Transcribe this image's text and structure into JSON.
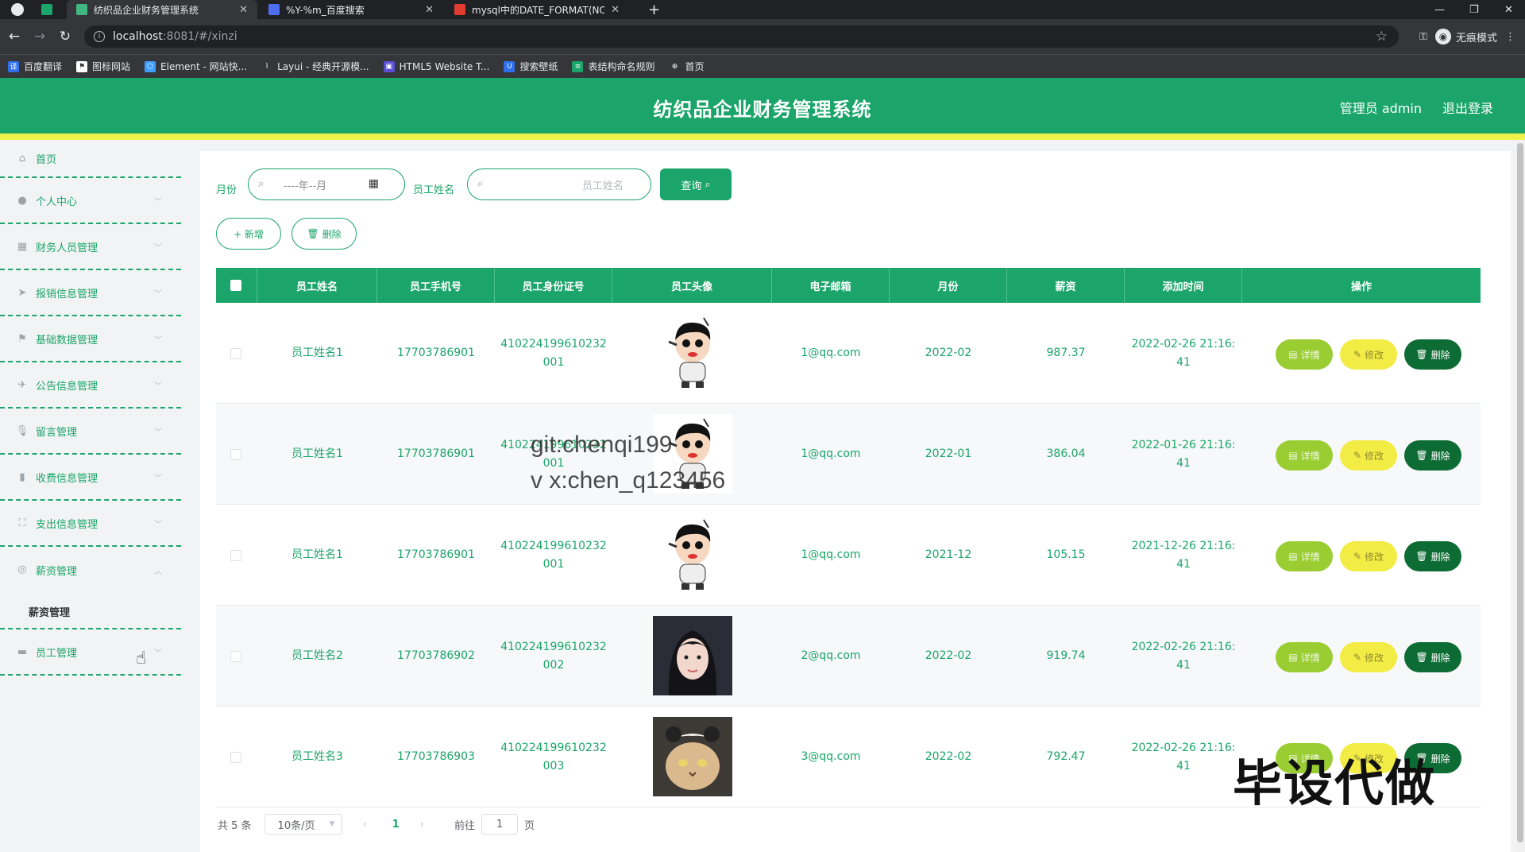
{
  "browser": {
    "tabs": [
      {
        "title": "纺织品企业财务管理系统"
      },
      {
        "title": "%Y-%m_百度搜索"
      },
      {
        "title": "mysql中的DATE_FORMAT(NO"
      }
    ],
    "url_host": "localhost",
    "url_path": ":8081/#/xinzi",
    "incognito_label": "无痕模式",
    "bookmarks": [
      "百度翻译",
      "图标网站",
      "Element - 网站快...",
      "Layui - 经典开源模...",
      "HTML5 Website T...",
      "搜索壁纸",
      "表结构命名规则",
      "首页"
    ]
  },
  "header": {
    "title": "纺织品企业财务管理系统",
    "user": "管理员 admin",
    "logout": "退出登录"
  },
  "sidebar": {
    "items": [
      {
        "label": "首页",
        "icon": "home-icon"
      },
      {
        "label": "个人中心",
        "icon": "user-icon"
      },
      {
        "label": "财务人员管理",
        "icon": "grid-icon"
      },
      {
        "label": "报销信息管理",
        "icon": "send-icon"
      },
      {
        "label": "基础数据管理",
        "icon": "flag-icon"
      },
      {
        "label": "公告信息管理",
        "icon": "plane-icon"
      },
      {
        "label": "留言管理",
        "icon": "mic-icon"
      },
      {
        "label": "收费信息管理",
        "icon": "chart-icon"
      },
      {
        "label": "支出信息管理",
        "icon": "crop-icon"
      },
      {
        "label": "薪资管理",
        "icon": "globe-icon"
      },
      {
        "label": "员工管理",
        "icon": "monitor-icon"
      }
    ],
    "submenu": "薪资管理"
  },
  "search": {
    "month_label": "月份",
    "month_placeholder": "----年--月",
    "name_label": "员工姓名",
    "name_placeholder": "员工姓名",
    "query_button": "查询"
  },
  "actions": {
    "add": "+ 新增",
    "delete": "删除"
  },
  "table": {
    "columns": [
      "员工姓名",
      "员工手机号",
      "员工身份证号",
      "员工头像",
      "电子邮箱",
      "月份",
      "薪资",
      "添加时间",
      "操作"
    ],
    "rows": [
      {
        "name": "员工姓名1",
        "phone": "17703786901",
        "id1": "410224199610232",
        "id2": "001",
        "email": "1@qq.com",
        "month": "2022-02",
        "salary": "987.37",
        "t1": "2022-02-26 21:16:",
        "t2": "41",
        "avatar": "cartoon"
      },
      {
        "name": "员工姓名1",
        "phone": "17703786901",
        "id1": "410224199610232",
        "id2": "001",
        "email": "1@qq.com",
        "month": "2022-01",
        "salary": "386.04",
        "t1": "2022-01-26 21:16:",
        "t2": "41",
        "avatar": "cartoon"
      },
      {
        "name": "员工姓名1",
        "phone": "17703786901",
        "id1": "410224199610232",
        "id2": "001",
        "email": "1@qq.com",
        "month": "2021-12",
        "salary": "105.15",
        "t1": "2021-12-26 21:16:",
        "t2": "41",
        "avatar": "cartoon"
      },
      {
        "name": "员工姓名2",
        "phone": "17703786902",
        "id1": "410224199610232",
        "id2": "002",
        "email": "2@qq.com",
        "month": "2022-02",
        "salary": "919.74",
        "t1": "2022-02-26 21:16:",
        "t2": "41",
        "avatar": "girl"
      },
      {
        "name": "员工姓名3",
        "phone": "17703786903",
        "id1": "410224199610232",
        "id2": "003",
        "email": "3@qq.com",
        "month": "2022-02",
        "salary": "792.47",
        "t1": "2022-02-26 21:16:",
        "t2": "41",
        "avatar": "cat"
      }
    ],
    "op_detail": "详情",
    "op_edit": "修改",
    "op_delete": "删除"
  },
  "pager": {
    "total": "共 5 条",
    "page_size": "10条/页",
    "current": "1",
    "goto_label": "前往",
    "goto_value": "1",
    "page_suffix": "页"
  },
  "overlays": {
    "line1": "git:chenqi199",
    "line2": "v x:chen_q123456",
    "brand": "毕设代做"
  }
}
